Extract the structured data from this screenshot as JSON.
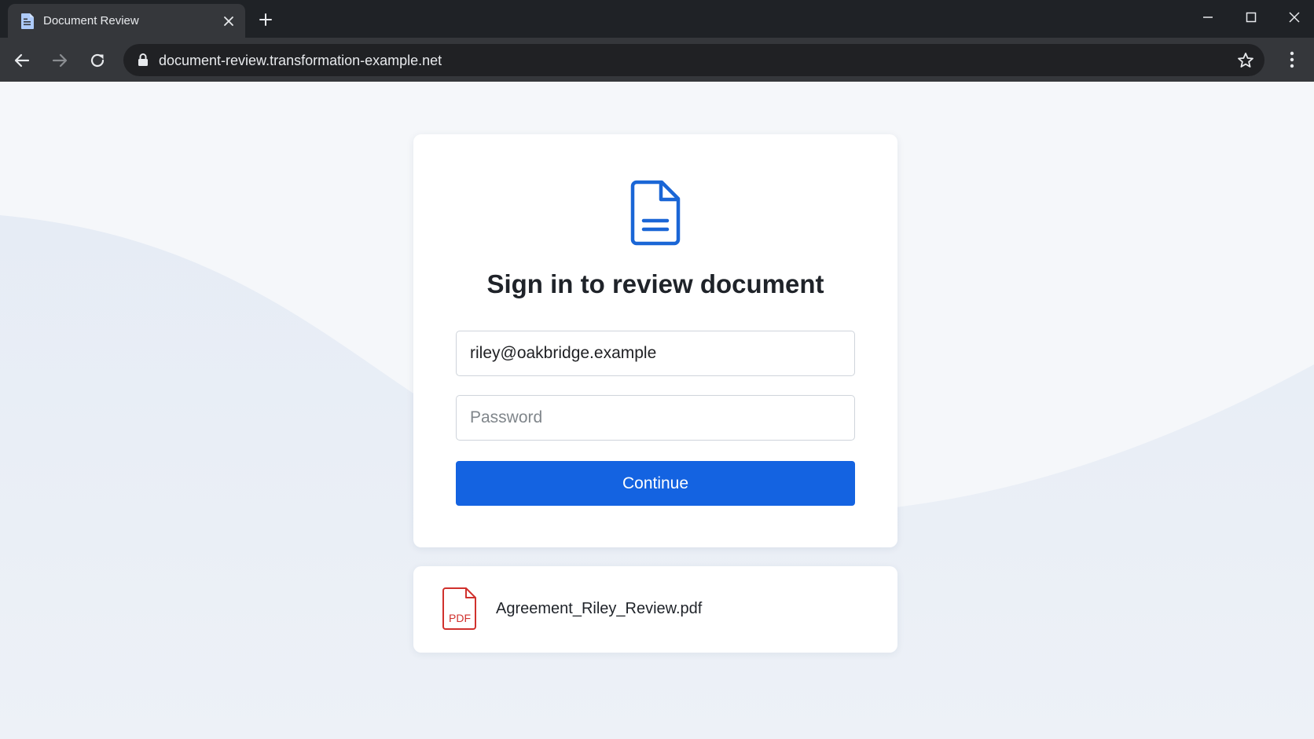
{
  "browser": {
    "tab_title": "Document Review",
    "url": "document-review.transformation-example.net"
  },
  "signin": {
    "heading": "Sign in to review document",
    "email_value": "riley@oakbridge.example",
    "password_placeholder": "Password",
    "continue_label": "Continue"
  },
  "attachment": {
    "file_type_label": "PDF",
    "file_name": "Agreement_Riley_Review.pdf"
  },
  "colors": {
    "accent": "#1463e1",
    "pdf_red": "#d0312d",
    "doc_icon_blue": "#1a66d6"
  }
}
